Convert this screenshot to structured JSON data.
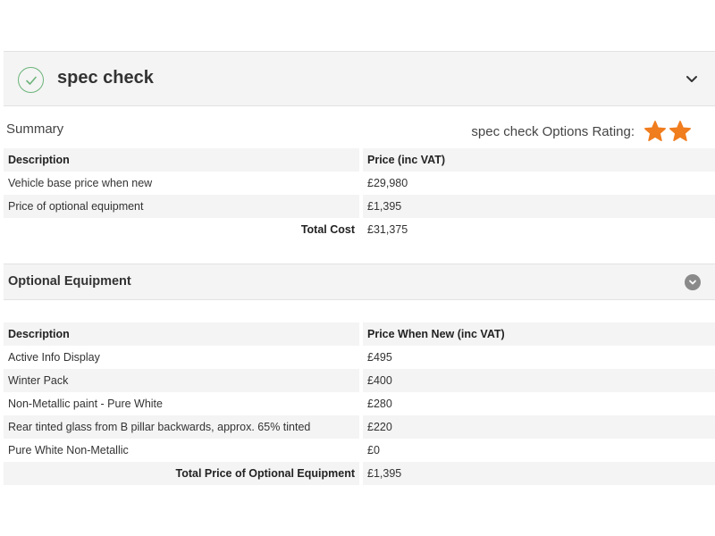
{
  "header": {
    "title": "spec check",
    "check_icon": "check-circle-icon",
    "expand_icon": "chevron-down-icon",
    "accent_color": "#6cb47a"
  },
  "summary": {
    "label": "Summary",
    "rating_label": "spec check Options Rating:",
    "rating_stars": 2,
    "star_color": "#f07d1e",
    "columns": [
      "Description",
      "Price (inc VAT)"
    ],
    "rows": [
      [
        "Vehicle base price when new",
        "£29,980"
      ],
      [
        "Price of optional equipment",
        "£1,395"
      ]
    ],
    "total_label": "Total Cost",
    "total_value": "£31,375"
  },
  "optional": {
    "title": "Optional Equipment",
    "toggle_icon": "chevron-down-circle-icon",
    "columns": [
      "Description",
      "Price When New (inc VAT)"
    ],
    "rows": [
      [
        "Active Info Display",
        "£495"
      ],
      [
        "Winter Pack",
        "£400"
      ],
      [
        "Non-Metallic paint - Pure White",
        "£280"
      ],
      [
        "Rear tinted glass from B pillar backwards, approx. 65% tinted",
        "£220"
      ],
      [
        "Pure White Non-Metallic",
        "£0"
      ]
    ],
    "total_label": "Total Price of Optional Equipment",
    "total_value": "£1,395"
  }
}
